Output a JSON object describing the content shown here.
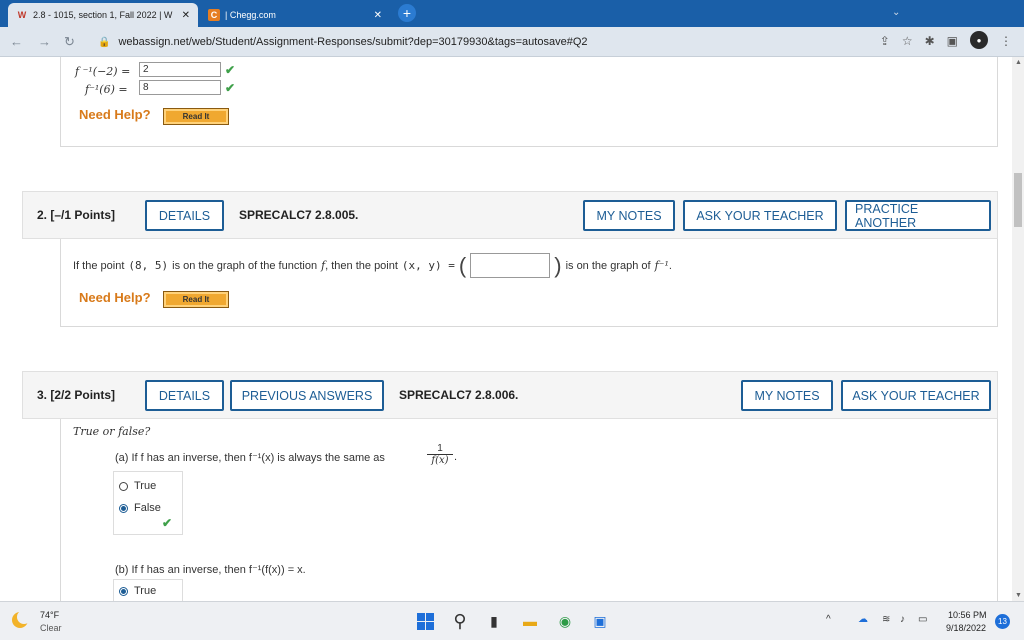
{
  "browser": {
    "tabs": [
      {
        "title": "2.8 - 1015, section 1, Fall 2022 | W",
        "icon": "webassign-icon"
      },
      {
        "title": "| Chegg.com",
        "icon": "chegg-icon"
      }
    ],
    "new_tab": "+",
    "url": "webassign.net/web/Student/Assignment-Responses/submit?dep=30179930&tags=autosave#Q2"
  },
  "q1": {
    "line1_label": "f ⁻¹(−2) =",
    "line1_value": "2",
    "line2_label": "f⁻¹(6) =",
    "line2_value": "8",
    "need_help": "Need Help?",
    "read_it": "Read It"
  },
  "q2": {
    "number": "2. [–/1 Points]",
    "details": "DETAILS",
    "code": "SPRECALC7 2.8.005.",
    "my_notes": "MY NOTES",
    "ask_teacher": "ASK YOUR TEACHER",
    "practice": "PRACTICE ANOTHER",
    "text_before": "If the point",
    "point": "(8, 5)",
    "text_mid": "is on the graph of the function",
    "fn": "f",
    "text_then": ", then the point",
    "xy": "(x, y) =",
    "open_paren": "(",
    "close_paren": ")",
    "answer": "",
    "text_after": "is on the graph of",
    "finv": "f⁻¹",
    "period": ".",
    "need_help": "Need Help?",
    "read_it": "Read It"
  },
  "q3": {
    "number": "3. [2/2 Points]",
    "details": "DETAILS",
    "previous": "PREVIOUS ANSWERS",
    "code": "SPRECALC7 2.8.006.",
    "my_notes": "MY NOTES",
    "ask_teacher": "ASK YOUR TEACHER",
    "prompt": "True or false?",
    "a_text": "(a) If f has an inverse, then  f⁻¹(x)  is always the same as",
    "a_num": "1",
    "a_den": "f(x)",
    "a_period": ".",
    "a_opt_true": "True",
    "a_opt_false": "False",
    "b_text": "(b) If f has an inverse, then  f⁻¹(f(x)) = x.",
    "b_opt_true": "True"
  },
  "taskbar": {
    "temp": "74°F",
    "condition": "Clear",
    "time": "10:56 PM",
    "date": "9/18/2022",
    "notif_count": "13"
  },
  "colors": {
    "accent": "#1d5d95",
    "help": "#d87a1a",
    "correct": "#3fa04a",
    "tabbar": "#1a5fa8"
  }
}
